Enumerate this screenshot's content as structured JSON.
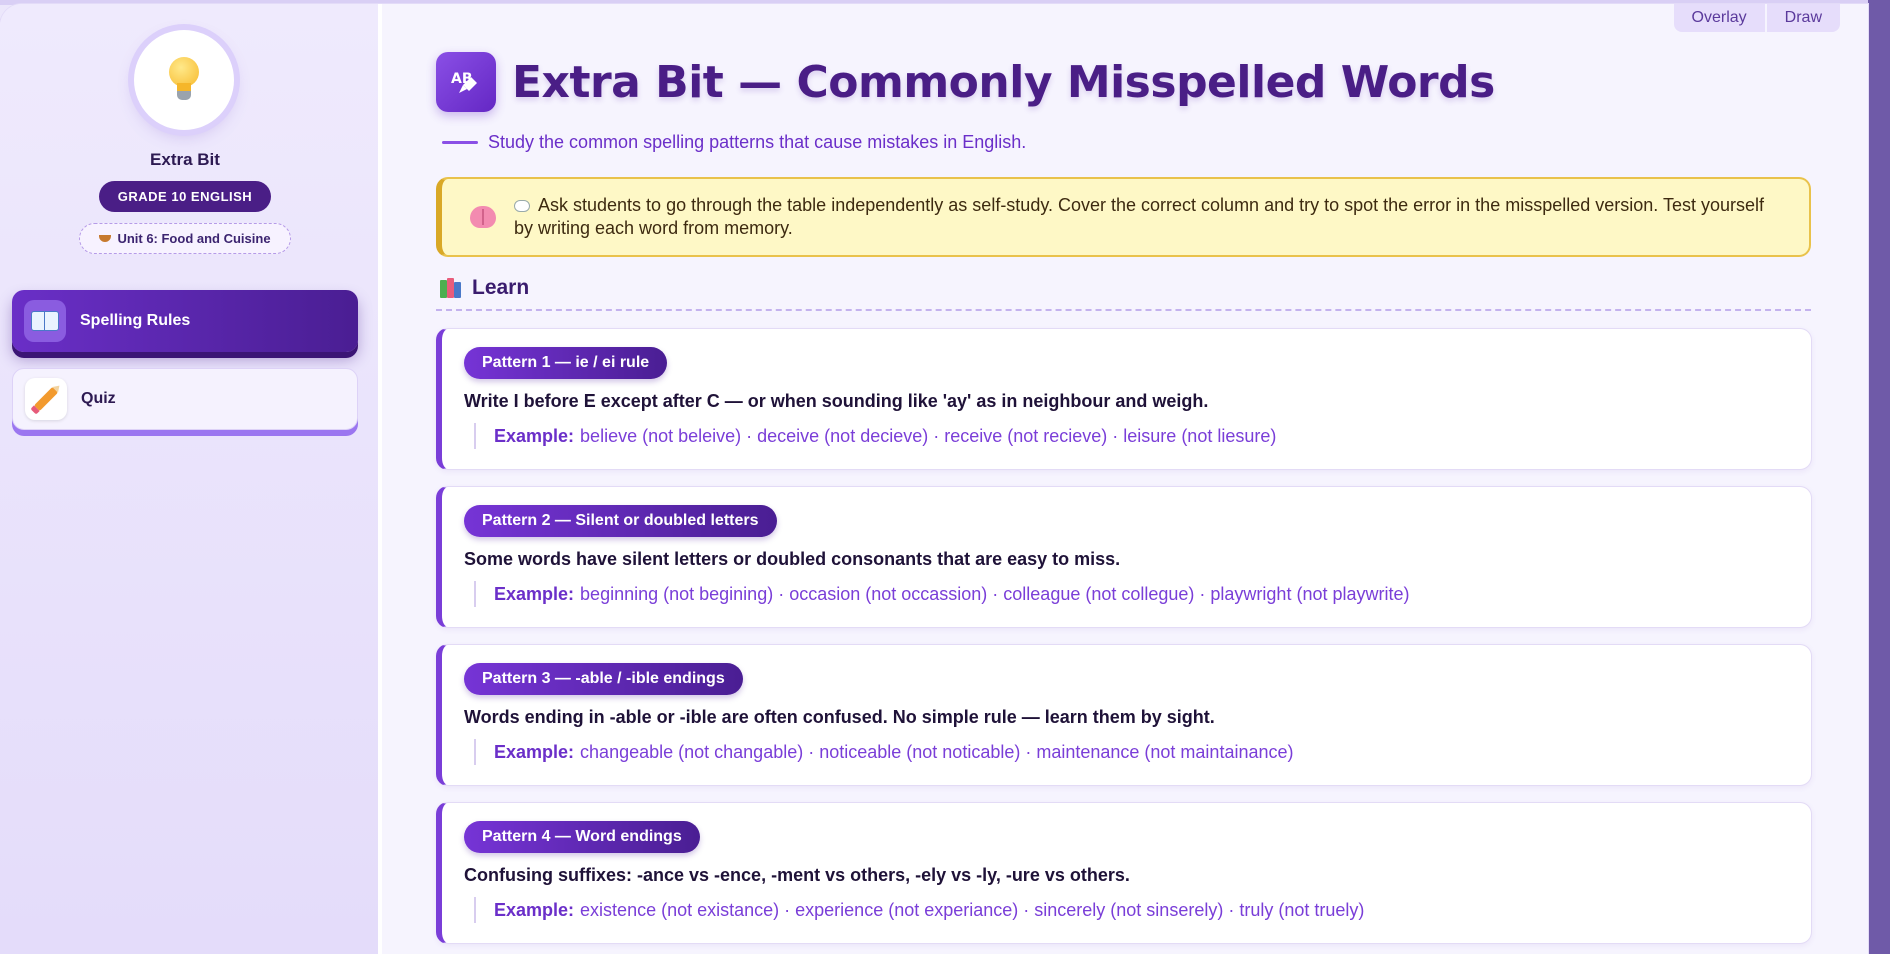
{
  "window": {
    "toggles": [
      "Overlay",
      "Draw"
    ]
  },
  "sidebar": {
    "avatar_icon": "lightbulb-icon",
    "brand": "Extra Bit",
    "grade_badge": "GRADE 10 ENGLISH",
    "unit_badge": "Unit 6: Food and Cuisine",
    "nav": [
      {
        "label": "Spelling Rules",
        "icon": "book-icon",
        "active": true
      },
      {
        "label": "Quiz",
        "icon": "pencil-icon",
        "active": false
      }
    ]
  },
  "header": {
    "title": "Extra Bit — Commonly Misspelled Words",
    "subtitle": "Study the common spelling patterns that cause mistakes in English."
  },
  "note": {
    "text": "Ask students to go through the table independently as self-study. Cover the correct column and try to spot the error in the misspelled version. Test yourself by writing each word from memory."
  },
  "section": {
    "title": "Learn"
  },
  "patterns": [
    {
      "label": "Pattern 1 — ie / ei rule",
      "rule": "Write I before E except after C — or when sounding like 'ay' as in neighbour and weigh.",
      "example_label": "Example:",
      "example": "believe (not beleive) · deceive (not decieve) · receive (not recieve) · leisure (not liesure)"
    },
    {
      "label": "Pattern 2 — Silent or doubled letters",
      "rule": "Some words have silent letters or doubled consonants that are easy to miss.",
      "example_label": "Example:",
      "example": "beginning (not begining) · occasion (not occassion) · colleague (not collegue) · playwright (not playwrite)"
    },
    {
      "label": "Pattern 3 — -able / -ible endings",
      "rule": "Words ending in -able or -ible are often confused. No simple rule — learn them by sight.",
      "example_label": "Example:",
      "example": "changeable (not changable) · noticeable (not noticable) · maintenance (not maintainance)"
    },
    {
      "label": "Pattern 4 — Word endings",
      "rule": "Confusing suffixes: -ance vs -ence, -ment vs others, -ely vs -ly, -ure vs others.",
      "example_label": "Example:",
      "example": "existence (not existance) · experience (not experiance) · sincerely (not sinserely) · truly (not truely)"
    }
  ],
  "colors": {
    "primary": "#4a1e86",
    "accent": "#7a3ed8",
    "note_bg": "#fef8c6",
    "note_border": "#e9c24b"
  }
}
